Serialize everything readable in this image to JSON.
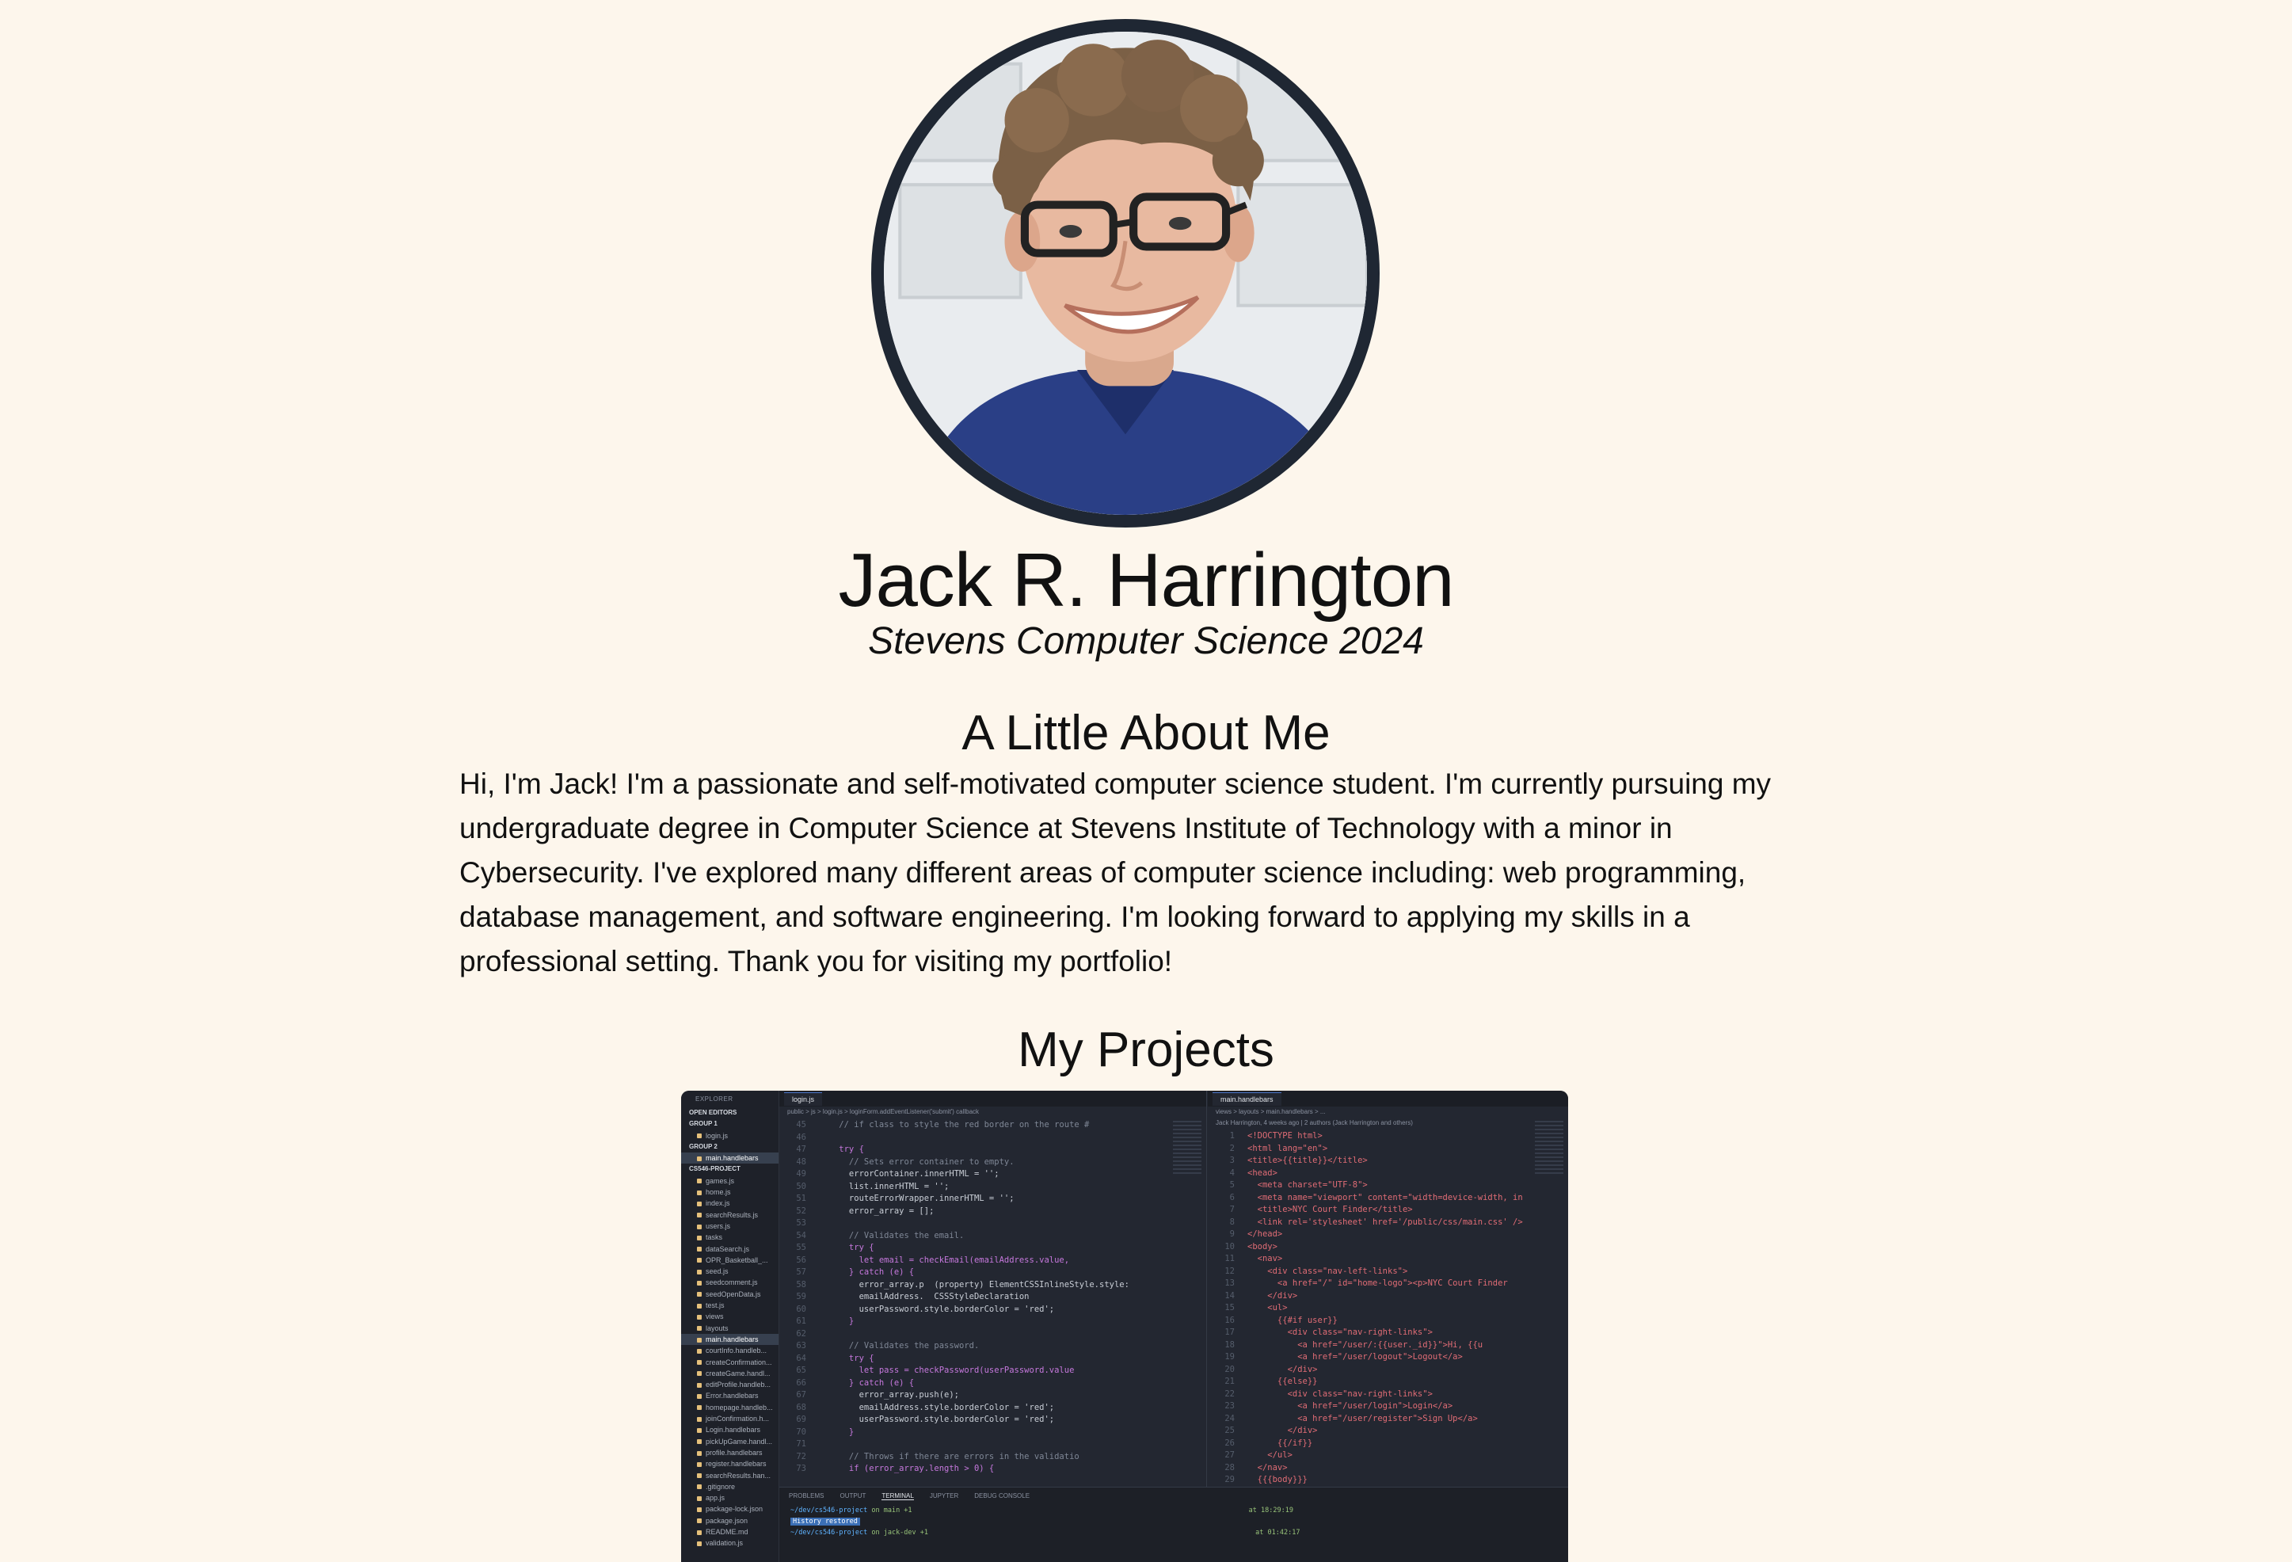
{
  "profile": {
    "name": "Jack R. Harrington",
    "subtitle": "Stevens Computer Science 2024"
  },
  "about": {
    "heading": "A Little About Me",
    "text": "Hi, I'm Jack! I'm a passionate and self-motivated computer science student. I'm currently pursuing my undergraduate degree in Computer Science at Stevens Institute of Technology with a minor in Cybersecurity. I've explored many different areas of computer science including: web programming, database management, and software engineering. I'm looking forward to applying my skills in a professional setting. Thank you for visiting my portfolio!"
  },
  "projects": {
    "heading": "My Projects"
  },
  "editor": {
    "explorer_title": "EXPLORER",
    "open_editors": "OPEN EDITORS",
    "group1": "GROUP 1",
    "group1_file": "login.js",
    "group2": "GROUP 2",
    "group2_file": "main.handlebars",
    "project": "CS546-PROJECT",
    "files": [
      "games.js",
      "home.js",
      "index.js",
      "searchResults.js",
      "users.js",
      "tasks",
      "dataSearch.js",
      "OPR_Basketball_...",
      "seed.js",
      "seedcomment.js",
      "seedOpenData.js",
      "test.js",
      "views",
      "layouts",
      "main.handlebars",
      "courtInfo.handleb...",
      "createConfirmation...",
      "createGame.handl...",
      "editProfile.handleb...",
      "Error.handlebars",
      "homepage.handleb...",
      "joinConfirmation.h...",
      "Login.handlebars",
      "pickUpGame.handl...",
      "profile.handlebars",
      "register.handlebars",
      "searchResults.han...",
      ".gitignore",
      "app.js",
      "package-lock.json",
      "package.json",
      "README.md",
      "validation.js"
    ],
    "left_tab": "login.js",
    "left_crumb": "public > js > login.js > loginForm.addEventListener('submit') callback",
    "left_code": [
      {
        "n": "45",
        "t": "    // if class to style the red border on the route #"
      },
      {
        "n": "46",
        "t": ""
      },
      {
        "n": "47",
        "t": "    try {"
      },
      {
        "n": "48",
        "t": "      // Sets error container to empty."
      },
      {
        "n": "49",
        "t": "      errorContainer.innerHTML = '';"
      },
      {
        "n": "50",
        "t": "      list.innerHTML = '';"
      },
      {
        "n": "51",
        "t": "      routeErrorWrapper.innerHTML = '';"
      },
      {
        "n": "52",
        "t": "      error_array = [];"
      },
      {
        "n": "53",
        "t": ""
      },
      {
        "n": "54",
        "t": "      // Validates the email."
      },
      {
        "n": "55",
        "t": "      try {"
      },
      {
        "n": "56",
        "t": "        let email = checkEmail(emailAddress.value,"
      },
      {
        "n": "57",
        "t": "      } catch (e) {"
      },
      {
        "n": "58",
        "t": "        error_array.p  (property) ElementCSSInlineStyle.style:"
      },
      {
        "n": "59",
        "t": "        emailAddress.  CSSStyleDeclaration"
      },
      {
        "n": "60",
        "t": "        userPassword.style.borderColor = 'red';"
      },
      {
        "n": "61",
        "t": "      }"
      },
      {
        "n": "62",
        "t": ""
      },
      {
        "n": "63",
        "t": "      // Validates the password."
      },
      {
        "n": "64",
        "t": "      try {"
      },
      {
        "n": "65",
        "t": "        let pass = checkPassword(userPassword.value"
      },
      {
        "n": "66",
        "t": "      } catch (e) {"
      },
      {
        "n": "67",
        "t": "        error_array.push(e);"
      },
      {
        "n": "68",
        "t": "        emailAddress.style.borderColor = 'red';"
      },
      {
        "n": "69",
        "t": "        userPassword.style.borderColor = 'red';"
      },
      {
        "n": "70",
        "t": "      }"
      },
      {
        "n": "71",
        "t": ""
      },
      {
        "n": "72",
        "t": "      // Throws if there are errors in the validatio"
      },
      {
        "n": "73",
        "t": "      if (error_array.length > 0) {"
      }
    ],
    "right_tab": "main.handlebars",
    "right_crumb": "views > layouts > main.handlebars > ...",
    "right_blame": "Jack Harrington, 4 weeks ago | 2 authors (Jack Harrington and others)",
    "right_code": [
      {
        "n": "1",
        "t": "<!DOCTYPE html>"
      },
      {
        "n": "2",
        "t": "<html lang=\"en\">"
      },
      {
        "n": "3",
        "t": "<title>{{title}}</title>"
      },
      {
        "n": "4",
        "t": "<head>"
      },
      {
        "n": "5",
        "t": "  <meta charset=\"UTF-8\">"
      },
      {
        "n": "6",
        "t": "  <meta name=\"viewport\" content=\"width=device-width, in"
      },
      {
        "n": "7",
        "t": "  <title>NYC Court Finder</title>"
      },
      {
        "n": "8",
        "t": "  <link rel='stylesheet' href='/public/css/main.css' />"
      },
      {
        "n": "9",
        "t": "</head>"
      },
      {
        "n": "10",
        "t": "<body>"
      },
      {
        "n": "11",
        "t": "  <nav>"
      },
      {
        "n": "12",
        "t": "    <div class=\"nav-left-links\">"
      },
      {
        "n": "13",
        "t": "      <a href=\"/\" id=\"home-logo\"><p>NYC Court Finder"
      },
      {
        "n": "14",
        "t": "    </div>"
      },
      {
        "n": "15",
        "t": "    <ul>"
      },
      {
        "n": "16",
        "t": "      {{#if user}}"
      },
      {
        "n": "17",
        "t": "        <div class=\"nav-right-links\">"
      },
      {
        "n": "18",
        "t": "          <a href=\"/user/:{{user._id}}\">Hi, {{u"
      },
      {
        "n": "19",
        "t": "          <a href=\"/user/logout\">Logout</a>"
      },
      {
        "n": "20",
        "t": "        </div>"
      },
      {
        "n": "21",
        "t": "      {{else}}"
      },
      {
        "n": "22",
        "t": "        <div class=\"nav-right-links\">"
      },
      {
        "n": "23",
        "t": "          <a href=\"/user/login\">Login</a>"
      },
      {
        "n": "24",
        "t": "          <a href=\"/user/register\">Sign Up</a>"
      },
      {
        "n": "25",
        "t": "        </div>"
      },
      {
        "n": "26",
        "t": "      {{/if}}"
      },
      {
        "n": "27",
        "t": "    </ul>"
      },
      {
        "n": "28",
        "t": "  </nav>"
      },
      {
        "n": "29",
        "t": "  {{{body}}}"
      }
    ],
    "panel_tabs": [
      "PROBLEMS",
      "OUTPUT",
      "TERMINAL",
      "JUPYTER",
      "DEBUG CONSOLE"
    ],
    "terminal": {
      "line1_path": "~/dev/cs546-project",
      "line1_branch": "on main +1",
      "line1_time": "at 18:29:19",
      "history": "History restored",
      "line2_path": "~/dev/cs546-project",
      "line2_branch": "on jack-dev +1",
      "line2_time": "at 01:42:17"
    }
  }
}
